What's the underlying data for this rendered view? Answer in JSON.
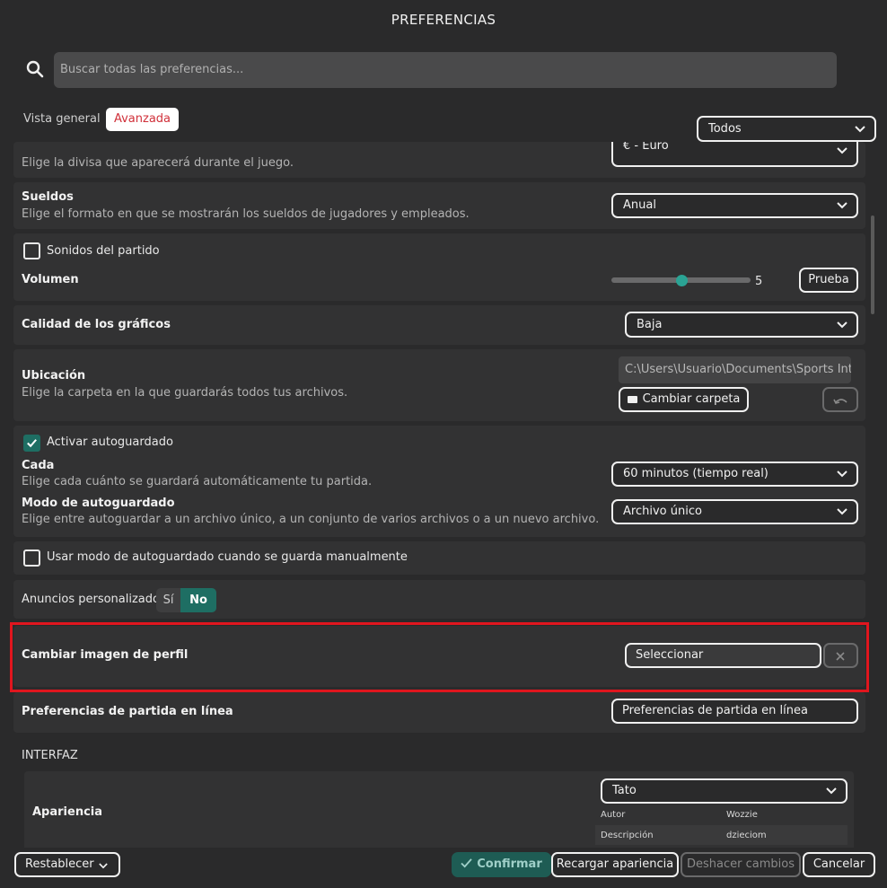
{
  "window": {
    "title": "PREFERENCIAS"
  },
  "search": {
    "placeholder": "Buscar todas las preferencias..."
  },
  "tabs": [
    {
      "label": "Vista general"
    },
    {
      "label": "Avanzada"
    }
  ],
  "filter": {
    "value": "Todos"
  },
  "settings": {
    "currency": {
      "desc": "Elige la divisa que aparecerá durante el juego.",
      "value": "€ - Euro"
    },
    "salaries": {
      "label": "Sueldos",
      "desc": "Elige el formato en que se mostrarán los sueldos de jugadores y empleados.",
      "value": "Anual"
    },
    "sound": {
      "checkbox": "Sonidos del partido",
      "volume_label": "Volumen",
      "volume_value": "5",
      "volume_level": 0.5,
      "test_button": "Prueba"
    },
    "graphics": {
      "label": "Calidad de los gráficos",
      "value": "Baja"
    },
    "location": {
      "label": "Ubicación",
      "desc": "Elige la carpeta en la que guardarás todos tus archivos.",
      "path": "C:\\Users\\Usuario\\Documents\\Sports Int...",
      "change_button": "Cambiar carpeta"
    },
    "autosave": {
      "checkbox": "Activar autoguardado",
      "every_label": "Cada",
      "every_desc": "Elige cada cuánto se guardará automáticamente tu partida.",
      "every_value": "60 minutos (tiempo real)",
      "mode_label": "Modo de autoguardado",
      "mode_desc": "Elige entre autoguardar a un archivo único, a un conjunto de varios archivos o a un nuevo archivo.",
      "mode_value": "Archivo único"
    },
    "manual_autosave": {
      "checkbox": "Usar modo de autoguardado cuando se guarda manualmente"
    },
    "ads": {
      "label": "Anuncios personalizados",
      "yes": "Sí",
      "no": "No"
    },
    "profile_image": {
      "label": "Cambiar imagen de perfil",
      "button": "Seleccionar"
    },
    "online": {
      "label": "Preferencias de partida en línea",
      "button": "Preferencias de partida en línea"
    }
  },
  "interface": {
    "section": "INTERFAZ",
    "appearance": {
      "label": "Apariencia",
      "value": "Tato",
      "rows": [
        {
          "key": "Autor",
          "value": "Wozzie"
        },
        {
          "key": "Descripción",
          "value": "dzieciom"
        }
      ]
    }
  },
  "footer": {
    "reset": "Restablecer",
    "confirm": "Confirmar",
    "reload": "Recargar apariencia",
    "undo": "Deshacer cambios",
    "cancel": "Cancelar"
  },
  "colors": {
    "accent": "#1e6e63",
    "highlight": "#e0161e",
    "background": "#2a2a2b",
    "card": "#323233"
  }
}
